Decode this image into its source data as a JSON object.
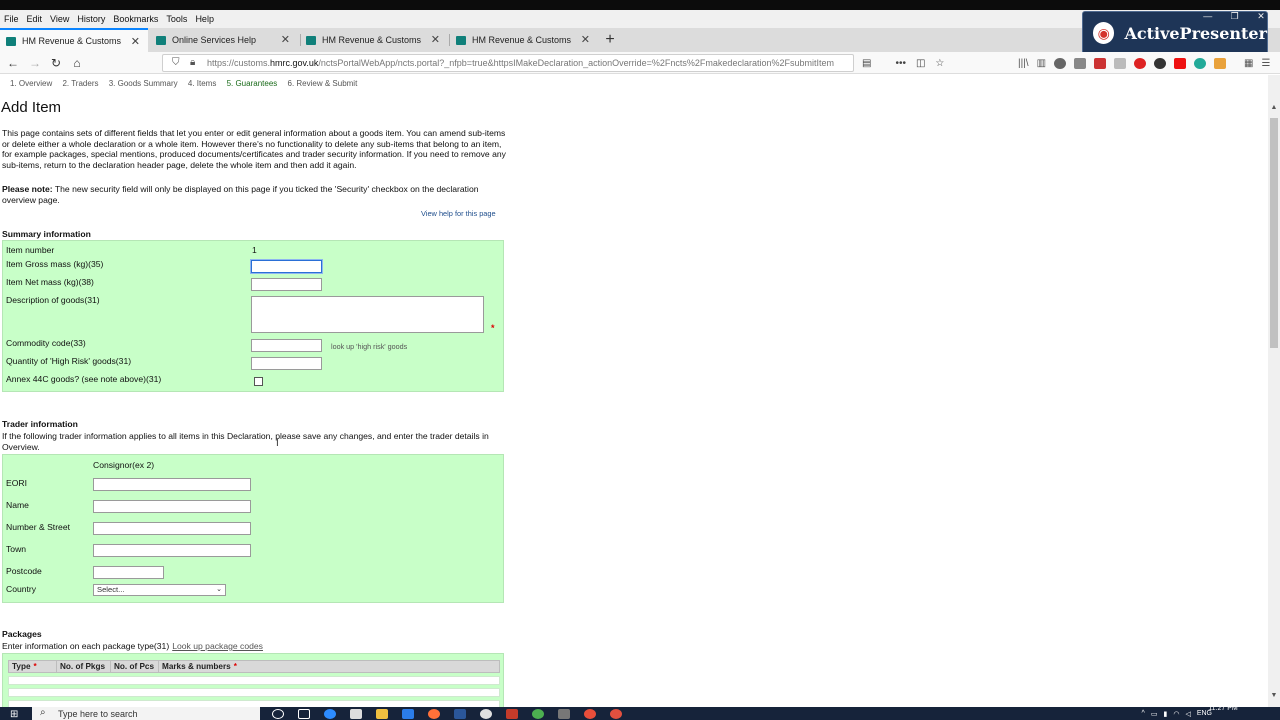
{
  "menu": [
    "File",
    "Edit",
    "View",
    "History",
    "Bookmarks",
    "Tools",
    "Help"
  ],
  "tabs": [
    {
      "title": "HM Revenue & Customs",
      "active": true
    },
    {
      "title": "Online Services Help",
      "active": false
    },
    {
      "title": "HM Revenue & Customs",
      "active": false
    },
    {
      "title": "HM Revenue & Customs",
      "active": false
    }
  ],
  "newtab": "+",
  "overlay": {
    "brand": "ActivePresenter"
  },
  "nav": {
    "url_prefix": "https://customs.",
    "url_domain": "hmrc.gov.uk",
    "url_suffix": "/nctsPortalWebApp/ncts.portal?_nfpb=true&httpsIMakeDeclaration_actionOverride=%2Fncts%2Fmakedeclaration%2FsubmitItem"
  },
  "steps": [
    "1. Overview",
    "2. Traders",
    "3. Goods Summary",
    "4. Items",
    "5. Guarantees",
    "6. Review & Submit"
  ],
  "page": {
    "title": "Add Item",
    "intro": "This page contains sets of different fields that let you enter or edit general information about a goods item. You can amend sub-items or delete either a whole declaration or a whole item. However there's no functionality to delete any sub-items that belong to an item, for example packages, special mentions, produced documents/certificates and trader security information. If you need to remove any sub-items, return to the declaration header page, delete the whole item and then add it again.",
    "note_label": "Please note:",
    "note_text": " The new security field will only be displayed on this page if you ticked the 'Security' checkbox on the declaration overview page.",
    "view_help": "View help for this page"
  },
  "summary": {
    "title": "Summary information",
    "item_number_label": "Item number",
    "item_number_value": "1",
    "gross_mass_label": "Item Gross mass (kg)(35)",
    "net_mass_label": "Item Net mass (kg)(38)",
    "description_label": "Description of goods(31)",
    "commodity_label": "Commodity code(33)",
    "high_risk_link": "look up 'high risk' goods",
    "quantity_label": "Quantity of 'High Risk' goods(31)",
    "annex_label": "Annex 44C goods? (see note above)(31)",
    "required_mark": "*"
  },
  "trader": {
    "title": "Trader information",
    "text": "If the following trader information applies to all items in this Declaration, please save any changes, and enter the trader details in Overview.",
    "column": "Consignor(ex 2)",
    "eori_label": "EORI",
    "name_label": "Name",
    "street_label": "Number & Street",
    "town_label": "Town",
    "postcode_label": "Postcode",
    "country_label": "Country",
    "country_value": "Select..."
  },
  "packages": {
    "title": "Packages",
    "text": "Enter information on each package type(31)",
    "link": "Look up package codes",
    "headers": [
      "Type",
      "No. of Pkgs",
      "No. of Pcs",
      "Marks & numbers"
    ],
    "required_mark": "*"
  },
  "taskbar": {
    "search_placeholder": "Type here to search",
    "lang": "ENG",
    "time": "11:27 PM"
  }
}
